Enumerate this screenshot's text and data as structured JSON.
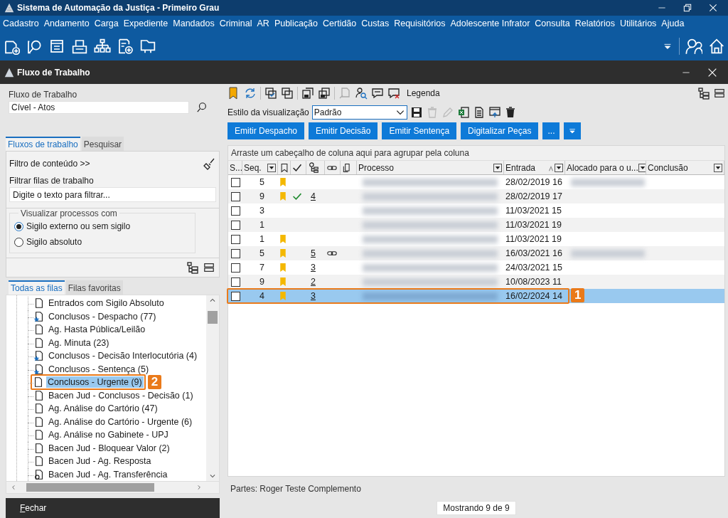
{
  "app_title": "Sistema de Automação da Justiça - Primeiro Grau",
  "menu": [
    "Cadastro",
    "Andamento",
    "Carga",
    "Expediente",
    "Mandados",
    "Criminal",
    "AR",
    "Publicação",
    "Certidão",
    "Custas",
    "Requisitórios",
    "Adolescente Infrator",
    "Consulta",
    "Relatórios",
    "Utilitários",
    "Ajuda"
  ],
  "window": {
    "title": "Fluxo de Trabalho"
  },
  "left": {
    "workflow_label": "Fluxo de Trabalho",
    "workflow_value": "Cível - Atos",
    "tabs": [
      {
        "label": "Fluxos de trabalho",
        "selected": true
      },
      {
        "label": "Pesquisar",
        "selected": false
      }
    ],
    "filter_title": "Filtro de conteúdo >>",
    "filter_label": "Filtrar filas de trabalho",
    "filter_placeholder": "Digite o texto para filtrar...",
    "group_label": "Visualizar processos com",
    "radios": [
      {
        "label": "Sigilo externo ou sem sigilo",
        "selected": true
      },
      {
        "label": "Sigilo absoluto",
        "selected": false
      }
    ],
    "tree_tabs": [
      {
        "label": "Todas as filas",
        "selected": true
      },
      {
        "label": "Filas favoritas",
        "selected": false
      }
    ],
    "tree": [
      {
        "label": "Entrados com Sigilo Absoluto",
        "kind": "queue",
        "selected": false
      },
      {
        "label": "Conclusos - Despacho (77)",
        "kind": "starred",
        "selected": false
      },
      {
        "label": "Ag. Hasta Pública/Leilão",
        "kind": "queue",
        "selected": false
      },
      {
        "label": "Ag. Minuta (23)",
        "kind": "queue",
        "selected": false
      },
      {
        "label": "Conclusos - Decisão Interlocutória (4)",
        "kind": "starred",
        "selected": false
      },
      {
        "label": "Conclusos - Sentença (5)",
        "kind": "starred",
        "selected": false
      },
      {
        "label": "Conclusos - Urgente (9)",
        "kind": "queue",
        "selected": true,
        "callout": "2"
      },
      {
        "label": "Bacen Jud - Conclusos - Decisão (1)",
        "kind": "queue",
        "selected": false
      },
      {
        "label": "Ag. Análise do Cartório (47)",
        "kind": "queue",
        "selected": false
      },
      {
        "label": "Ag. Análise do Cartório - Urgente (6)",
        "kind": "queue",
        "selected": false
      },
      {
        "label": "Ag. Análise no Gabinete - UPJ",
        "kind": "queue",
        "selected": false
      },
      {
        "label": "Bacen Jud - Bloquear Valor (2)",
        "kind": "queue",
        "selected": false
      },
      {
        "label": "Bacen Jud - Ag. Resposta",
        "kind": "queue",
        "selected": false
      },
      {
        "label": "Bacen Jud - Ag. Transferência",
        "kind": "linked",
        "selected": false
      }
    ],
    "close_button": "Fechar"
  },
  "right": {
    "legend": "Legenda",
    "style_label": "Estilo da visualização",
    "style_value": "Padrão",
    "actions": [
      "Emitir Despacho",
      "Emitir Decisão",
      "Emitir Sentença",
      "Digitalizar Peças",
      "..."
    ],
    "group_hint": "Arraste um cabeçalho de coluna aqui para agrupar pela coluna",
    "columns": [
      {
        "kind": "text",
        "label": "S..."
      },
      {
        "kind": "text",
        "label": "Seq.",
        "filter": true
      },
      {
        "kind": "bookmark"
      },
      {
        "kind": "check"
      },
      {
        "kind": "hierarchy"
      },
      {
        "kind": "link"
      },
      {
        "kind": "document"
      },
      {
        "kind": "text",
        "label": "Processo",
        "filter": true
      },
      {
        "kind": "text",
        "label": "Entrada",
        "filter": true,
        "sorted": true
      },
      {
        "kind": "text",
        "label": "Alocado para o u...",
        "filter": true
      },
      {
        "kind": "text",
        "label": "Conclusão",
        "filter": true
      }
    ],
    "rows": [
      {
        "checked": false,
        "seq": "5",
        "bookmarked": true,
        "done": false,
        "count": "",
        "linked": false,
        "entrada": "28/02/2019 16",
        "allocated_hidden": true,
        "selected": false
      },
      {
        "checked": false,
        "seq": "9",
        "bookmarked": true,
        "done": true,
        "count": "4",
        "linked": false,
        "entrada": "28/02/2019 17",
        "allocated_hidden": false,
        "selected": false
      },
      {
        "checked": false,
        "seq": "3",
        "bookmarked": false,
        "done": false,
        "count": "",
        "linked": false,
        "entrada": "11/03/2021 15",
        "allocated_hidden": false,
        "selected": false
      },
      {
        "checked": false,
        "seq": "1",
        "bookmarked": false,
        "done": false,
        "count": "",
        "linked": false,
        "entrada": "11/03/2021 19",
        "allocated_hidden": false,
        "selected": false
      },
      {
        "checked": false,
        "seq": "1",
        "bookmarked": true,
        "done": false,
        "count": "",
        "linked": false,
        "entrada": "11/03/2021 19",
        "allocated_hidden": false,
        "selected": false
      },
      {
        "checked": false,
        "seq": "5",
        "bookmarked": true,
        "done": false,
        "count": "5",
        "linked": true,
        "entrada": "16/03/2021 16",
        "allocated_hidden": true,
        "selected": false
      },
      {
        "checked": false,
        "seq": "7",
        "bookmarked": true,
        "done": false,
        "count": "3",
        "linked": false,
        "entrada": "24/03/2021 15",
        "allocated_hidden": false,
        "selected": false
      },
      {
        "checked": false,
        "seq": "9",
        "bookmarked": true,
        "done": false,
        "count": "2",
        "linked": false,
        "entrada": "10/08/2023 11",
        "allocated_hidden": false,
        "selected": false
      },
      {
        "checked": false,
        "seq": "4",
        "bookmarked": true,
        "done": false,
        "count": "3",
        "linked": false,
        "entrada": "16/02/2024 14",
        "allocated_hidden": false,
        "selected": true,
        "callout": "1"
      }
    ],
    "parties": "Partes: Roger Teste Complemento",
    "count": "Mostrando 9 de 9"
  }
}
